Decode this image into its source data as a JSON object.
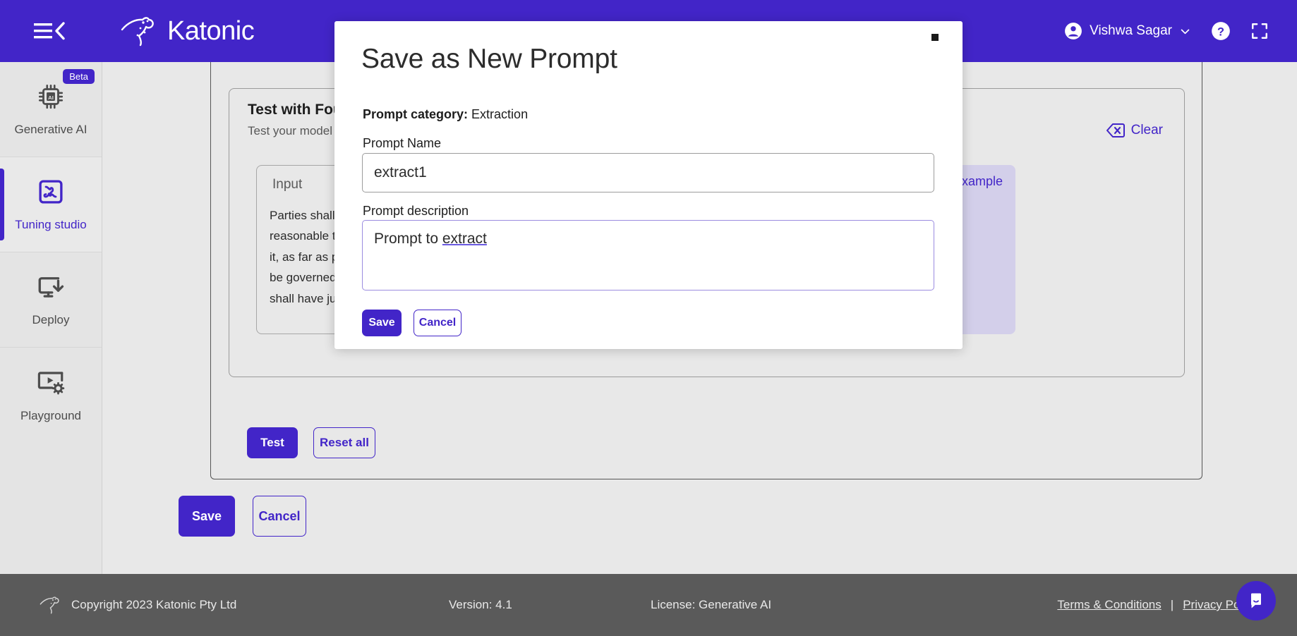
{
  "topbar": {
    "menu_icon": "hamburger-collapse-icon",
    "brand": "Katonic",
    "user_name": "Vishwa Sagar",
    "user_icon": "account-circle-icon",
    "chevron_icon": "chevron-down-icon",
    "help_icon": "help-circle-icon",
    "fullscreen_icon": "fullscreen-icon",
    "brand_color": "#4225c8"
  },
  "sidebar": {
    "items": [
      {
        "label": "Generative AI",
        "icon": "ai-chip-icon",
        "badge": "Beta",
        "active": false
      },
      {
        "label": "Tuning studio",
        "icon": "puzzle-piece-icon",
        "badge": "",
        "active": true
      },
      {
        "label": "Deploy",
        "icon": "deploy-download-icon",
        "badge": "",
        "active": false
      },
      {
        "label": "Playground",
        "icon": "playground-screen-gear-icon",
        "badge": "",
        "active": false
      }
    ]
  },
  "main": {
    "panel_title": "Test with Foundation Model",
    "panel_subtitle": "Test your model with your own input",
    "clear_label": "Clear",
    "clear_icon": "backspace-clear-icon",
    "input_label": "Input",
    "input_text": "Parties shall endeavour to resolve the dispute within a reasonable time. This Agreement and any dispute arising out of it, as far as possible, the remaining provisions of the Clause shall be governed by English law. The courts of England and Wales shall have jurisdiction.",
    "add_to_example_label": "+ Add to example",
    "test_label": "Test",
    "reset_label": "Reset all",
    "save_label": "Save",
    "cancel_label": "Cancel"
  },
  "modal": {
    "title": "Save as New Prompt",
    "category_label": "Prompt category:",
    "category_value": "Extraction",
    "name_label": "Prompt Name",
    "name_value": "extract1",
    "name_placeholder": "Prompt Name",
    "description_label": "Prompt description",
    "description_value": "Prompt to extract",
    "description_placeholder": "Prompt description",
    "description_prefix": "Prompt to ",
    "description_misspelled": "extract",
    "save_label": "Save",
    "cancel_label": "Cancel",
    "close_icon": "close-icon"
  },
  "footer": {
    "copyright": "Copyright 2023 Katonic Pty Ltd",
    "logo_icon": "kangaroo-logo-icon",
    "version": "Version: 4.1",
    "license": "License: Generative AI",
    "terms": "Terms & Conditions",
    "separator": "|",
    "privacy": "Privacy Policy",
    "chat_icon": "chat-bubble-icon"
  }
}
